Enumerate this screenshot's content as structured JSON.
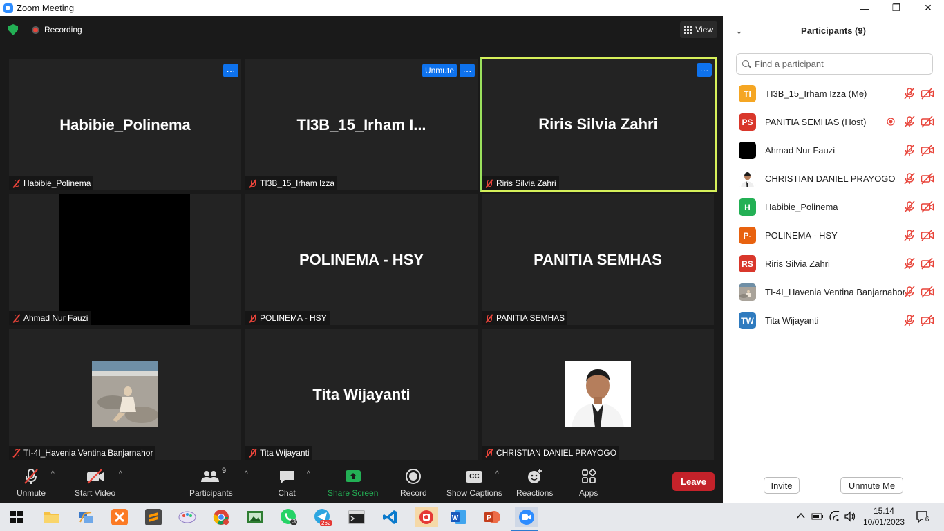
{
  "window": {
    "title": "Zoom Meeting",
    "controls": [
      "—",
      "❐",
      "✕"
    ]
  },
  "topbar": {
    "recording_label": "Recording",
    "view_label": "View"
  },
  "tiles": [
    {
      "big": "Habibie_Polinema",
      "label": "Habibie_Polinema"
    },
    {
      "big": "TI3B_15_Irham  I...",
      "label": "TI3B_15_Irham Izza",
      "unmute": "Unmute"
    },
    {
      "big": "Riris Silvia Zahri",
      "label": "Riris Silvia Zahri"
    },
    {
      "big": "",
      "label": "Ahmad Nur Fauzi"
    },
    {
      "big": "POLINEMA - HSY",
      "label": "POLINEMA - HSY"
    },
    {
      "big": "PANITIA SEMHAS",
      "label": "PANITIA SEMHAS"
    },
    {
      "big": "",
      "label": "TI-4I_Havenia Ventina Banjarnahor"
    },
    {
      "big": "Tita Wijayanti",
      "label": "Tita Wijayanti"
    },
    {
      "big": "",
      "label": "CHRISTIAN DANIEL PRAYOGO"
    }
  ],
  "tile_menu_glyph": "···",
  "toolbar": {
    "unmute": "Unmute",
    "start_video": "Start Video",
    "participants": "Participants",
    "participants_count": "9",
    "chat": "Chat",
    "share_screen": "Share Screen",
    "record": "Record",
    "show_captions": "Show Captions",
    "captions_icon_text": "CC",
    "reactions": "Reactions",
    "apps": "Apps",
    "leave": "Leave"
  },
  "panel": {
    "title": "Participants (9)",
    "search_placeholder": "Find a participant",
    "invite": "Invite",
    "unmute_me": "Unmute Me",
    "participants": [
      {
        "initials": "TI",
        "name": "TI3B_15_Irham Izza (Me)",
        "color": "#f5a623"
      },
      {
        "initials": "PS",
        "name": "PANITIA SEMHAS (Host)",
        "color": "#d9372b",
        "recording": true
      },
      {
        "initials": "",
        "name": "Ahmad Nur Fauzi",
        "color": "#000000"
      },
      {
        "initials": "",
        "name": "CHRISTIAN DANIEL PRAYOGO",
        "color": "#e9e9e9",
        "photo": "person"
      },
      {
        "initials": "H",
        "name": "Habibie_Polinema",
        "color": "#23b055"
      },
      {
        "initials": "P-",
        "name": "POLINEMA - HSY",
        "color": "#e8620f"
      },
      {
        "initials": "RS",
        "name": "Riris Silvia Zahri",
        "color": "#d9372b"
      },
      {
        "initials": "",
        "name": "TI-4I_Havenia Ventina Banjarnahor",
        "color": "#a8a29a",
        "photo": "beach"
      },
      {
        "initials": "TW",
        "name": "Tita Wijayanti",
        "color": "#2f7bbf"
      }
    ]
  },
  "taskbar": {
    "time": "15.14",
    "date": "10/01/2023",
    "whatsapp_badge": "3",
    "telegram_badge": "262",
    "notification_count": "6"
  },
  "colors": {
    "accent": "#0e72ed",
    "muted_red": "#e8443a",
    "leave_red": "#c4222a",
    "active_speaker": "#d6f05a",
    "share_green": "#23b055"
  }
}
